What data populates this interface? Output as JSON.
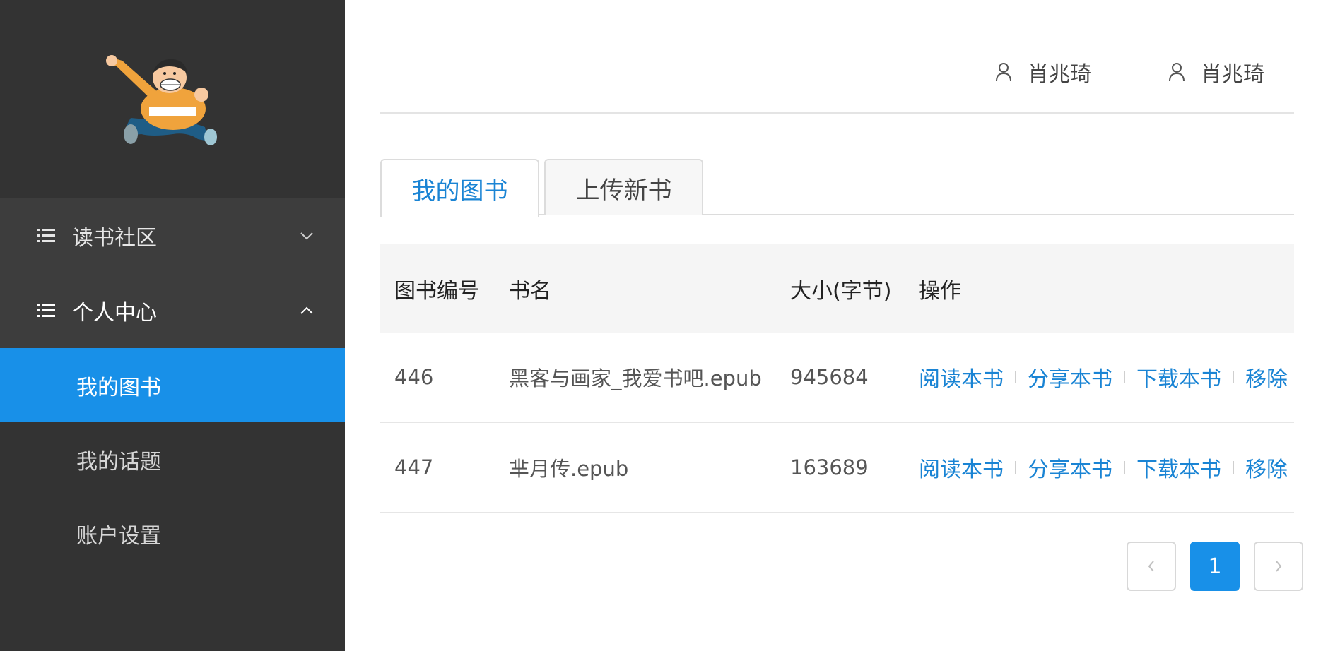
{
  "sidebar": {
    "logo_icon": "cartoon-character-logo",
    "groups": [
      {
        "label": "读书社区",
        "icon": "list-icon",
        "chevron": "chevron-down-icon"
      },
      {
        "label": "个人中心",
        "icon": "list-icon",
        "chevron": "chevron-up-icon"
      }
    ],
    "sub_items": [
      {
        "label": "我的图书",
        "active": true
      },
      {
        "label": "我的话题",
        "active": false
      },
      {
        "label": "账户设置",
        "active": false
      }
    ]
  },
  "header": {
    "users": [
      {
        "name": "肖兆琦",
        "icon": "user-icon"
      },
      {
        "name": "肖兆琦",
        "icon": "user-icon"
      }
    ]
  },
  "tabs": [
    {
      "label": "我的图书",
      "active": true
    },
    {
      "label": "上传新书",
      "active": false
    }
  ],
  "table": {
    "columns": [
      "图书编号",
      "书名",
      "大小(字节)",
      "操作"
    ],
    "rows": [
      {
        "id": "446",
        "name": "黑客与画家_我爱书吧.epub",
        "size": "945684"
      },
      {
        "id": "447",
        "name": "芈月传.epub",
        "size": "163689"
      }
    ],
    "actions": [
      "阅读本书",
      "分享本书",
      "下载本书",
      "移除"
    ]
  },
  "pagination": {
    "prev_icon": "chevron-left-icon",
    "current": "1",
    "next_icon": "chevron-right-icon"
  },
  "colors": {
    "sidebar_bg": "#333333",
    "accent": "#1890e8",
    "link": "#1a84d4"
  }
}
